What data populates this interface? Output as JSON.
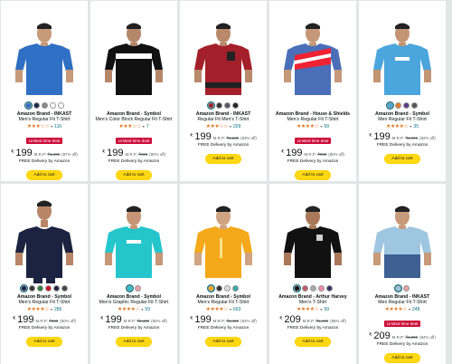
{
  "products": [
    {
      "brand": "Amazon Brand - INKAST",
      "desc": "Men's Regular Fit T-Shirt",
      "stars": "★★★☆☆",
      "count": "116",
      "deal": "Limited time deal",
      "price": "199",
      "mrp": "₹1,499",
      "off": "(87% off)",
      "delivery": "FREE Delivery by Amazon",
      "cart": "Add to cart",
      "shirt": "#2f6fc4",
      "skin": "#c79a7a",
      "swatches": [
        "#2f6fc4",
        "#1a2a4a",
        "#888",
        "#fff",
        "#fff"
      ]
    },
    {
      "brand": "Amazon Brand - Symbol",
      "desc": "Men's Color Block Regular Fit T-Shirt",
      "stars": "★★★☆☆",
      "count": "7",
      "deal": "Limited time deal",
      "price": "199",
      "mrp": "₹899",
      "off": "(80% off)",
      "delivery": "FREE Delivery by Amazon",
      "cart": "Add to cart",
      "shirt": "#111",
      "skin": "#b5876a",
      "swatches": []
    },
    {
      "brand": "Amazon Brand - INKAST",
      "desc": "Regular Fit Men's T-Shirt",
      "stars": "★★★☆☆",
      "count": "209",
      "deal": "",
      "price": "199",
      "mrp": "₹1,199",
      "off": "(83% off)",
      "delivery": "FREE Delivery by Amazon",
      "cart": "Add to cart",
      "shirt": "#a3202a",
      "skin": "#b88a6a",
      "swatches": [
        "#a3202a",
        "#333",
        "#556",
        "#222"
      ]
    },
    {
      "brand": "Amazon Brand - House & Shields",
      "desc": "Men's Regular Fit T-Shirt",
      "stars": "★★★★☆",
      "count": "99",
      "deal": "Limited time deal",
      "price": "199",
      "mrp": "₹999",
      "off": "(80% off)",
      "delivery": "FREE Delivery by Amazon",
      "cart": "Add to cart",
      "shirt": "#4a6fb8",
      "skin": "#c49878",
      "swatches": []
    },
    {
      "brand": "Amazon Brand - Symbol",
      "desc": "Men Regular Fit T-Shirt",
      "stars": "★★★★☆",
      "count": "35",
      "deal": "",
      "price": "199",
      "mrp": "₹2,499",
      "off": "(92% off)",
      "delivery": "FREE Delivery by Amazon",
      "cart": "Add to cart",
      "shirt": "#4aa6dc",
      "skin": "#c39474",
      "swatches": [
        "#4aa6dc",
        "#e87d2c",
        "#5b3a8a",
        "#555"
      ]
    },
    {
      "brand": "Amazon Brand - Symbol",
      "desc": "Men's Regular Fit T-Shirt",
      "stars": "★★★★☆",
      "count": "286",
      "deal": "",
      "price": "199",
      "mrp": "₹999",
      "off": "(80% off)",
      "delivery": "FREE Delivery by Amazon",
      "cart": "Add to cart",
      "shirt": "#1c2340",
      "skin": "#b88566",
      "swatches": [
        "#1c2340",
        "#333",
        "#2d7a3e",
        "#c12",
        "#224",
        "#444"
      ]
    },
    {
      "brand": "Amazon Brand - Symbol",
      "desc": "Men's Graphic Regular Fit T-Shirt",
      "stars": "★★★★☆",
      "count": "59",
      "deal": "",
      "price": "199",
      "mrp": "₹2,499",
      "off": "(92% off)",
      "delivery": "FREE Delivery by Amazon",
      "cart": "Add to cart",
      "shirt": "#24c6cc",
      "skin": "#c69676",
      "swatches": [
        "#24c6cc",
        "#e8a0a8"
      ]
    },
    {
      "brand": "Amazon Brand - Symbol",
      "desc": "Men's Regular Fit T-Shirt",
      "stars": "★★★★☆",
      "count": "693",
      "deal": "",
      "price": "199",
      "mrp": "₹2,499",
      "off": "(92% off)",
      "delivery": "FREE Delivery by Amazon",
      "cart": "Add to cart",
      "shirt": "#f4a91a",
      "skin": "#d0a482",
      "swatches": [
        "#f4a91a",
        "#333",
        "#ddd",
        "#3aa"
      ]
    },
    {
      "brand": "Amazon Brand - Arthur Harvey",
      "desc": "Men's T-Shirt",
      "stars": "★★★★☆",
      "count": "99",
      "deal": "",
      "price": "209",
      "mrp": "₹1,499",
      "off": "(86% off)",
      "delivery": "FREE Delivery by Amazon",
      "cart": "Add to cart",
      "shirt": "#111",
      "skin": "#a87858",
      "swatches": [
        "#111",
        "#c05a6a",
        "#aaa",
        "#e8a",
        "#336"
      ]
    },
    {
      "brand": "Amazon Brand - INKAST",
      "desc": "Men Regular Fit T-Shirt",
      "stars": "★★★★☆",
      "count": "248",
      "deal": "Limited time deal",
      "price": "209",
      "mrp": "₹1,399",
      "off": "(84% off)",
      "delivery": "FREE Delivery by Amazon",
      "cart": "Add to cart",
      "shirt": "#9fc6e0",
      "skin": "#c79a7a",
      "swatches": [
        "#9fc6e0",
        "#e8a0a8"
      ]
    }
  ]
}
